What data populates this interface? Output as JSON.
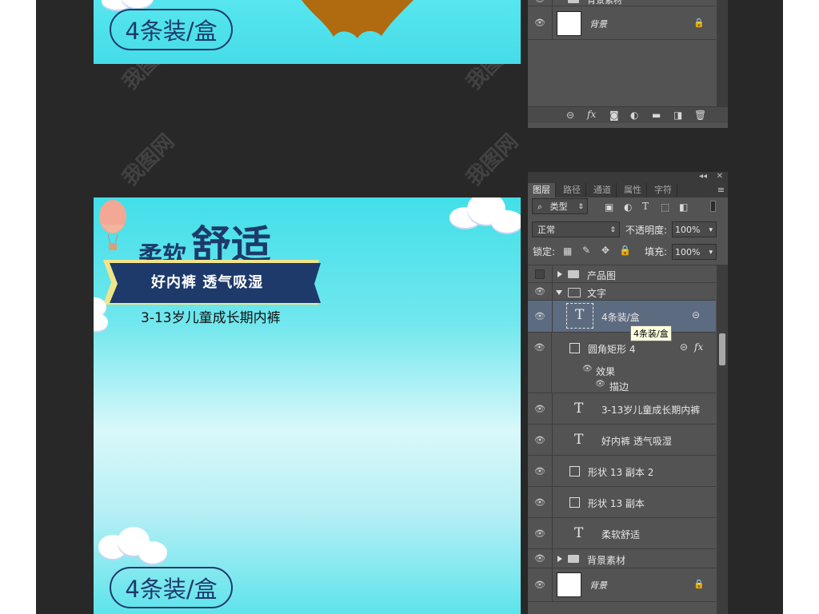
{
  "canvas_top": {
    "pill_text": "4条装/盒"
  },
  "canvas_bottom": {
    "title_part1": "柔软",
    "title_part2": "舒适",
    "banner_text": "好内裤 透气吸湿",
    "subtitle": "3-13岁儿童成长期内裤",
    "pill_text": "4条装/盒"
  },
  "panel_top": {
    "partial_layer_name": "背景素材",
    "background_layer": "背景",
    "footer_icons": [
      "link-icon",
      "fx-icon",
      "mask-icon",
      "adjustment-icon",
      "folder-icon",
      "new-layer-icon",
      "trash-icon"
    ]
  },
  "panel_main": {
    "tabs": [
      "图层",
      "路径",
      "通道",
      "属性",
      "字符"
    ],
    "filter_label": "类型",
    "blend_mode": "正常",
    "opacity_label": "不透明度:",
    "opacity_value": "100%",
    "lock_label": "锁定:",
    "fill_label": "填充:",
    "fill_value": "100%",
    "tooltip": "4条装/盒",
    "layers": [
      {
        "name": "产品图",
        "kind": "group",
        "visible": false,
        "expanded": false
      },
      {
        "name": "文字",
        "kind": "group",
        "visible": true,
        "expanded": true
      },
      {
        "name": "4条装/盒",
        "kind": "text",
        "visible": true,
        "selected": true
      },
      {
        "name": "圆角矩形 4",
        "kind": "shape",
        "visible": true
      },
      {
        "name": "效果",
        "kind": "effect"
      },
      {
        "name": "描边",
        "kind": "effect"
      },
      {
        "name": "3-13岁儿童成长期内裤",
        "kind": "text",
        "visible": true
      },
      {
        "name": "好内裤 透气吸湿",
        "kind": "text",
        "visible": true
      },
      {
        "name": "形状 13 副本 2",
        "kind": "shape",
        "visible": true
      },
      {
        "name": "形状 13 副本",
        "kind": "shape",
        "visible": true
      },
      {
        "name": "柔软舒适",
        "kind": "text",
        "visible": true
      },
      {
        "name": "背景素材",
        "kind": "group",
        "visible": true,
        "expanded": false
      },
      {
        "name": "背景",
        "kind": "background",
        "visible": true,
        "locked": true
      }
    ]
  },
  "colors": {
    "workspace": "#282828",
    "panel": "#535353",
    "selected_row": "#5c6b80",
    "navy": "#1d3a6b",
    "cyan": "#45dce8"
  },
  "watermark": "我图网"
}
